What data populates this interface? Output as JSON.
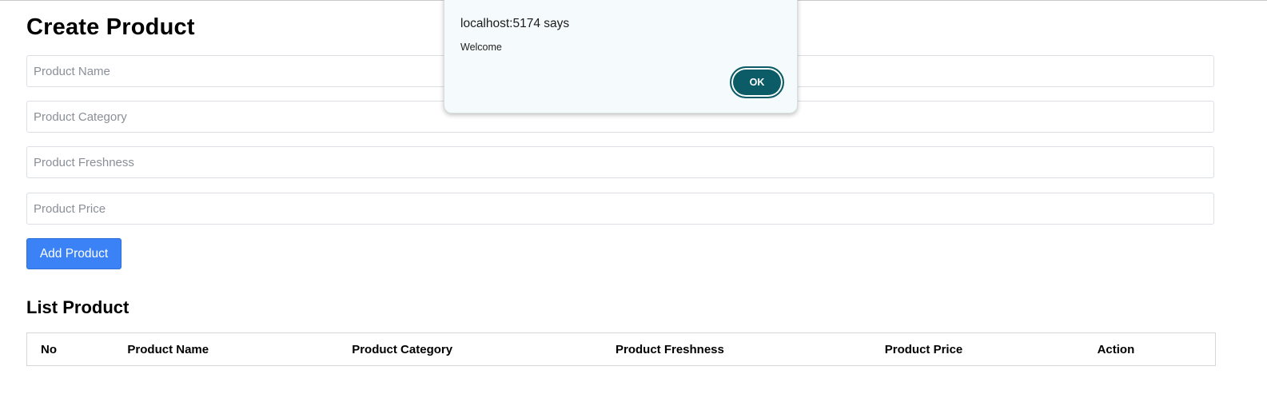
{
  "create": {
    "title": "Create Product",
    "fields": {
      "name_placeholder": "Product Name",
      "category_placeholder": "Product Category",
      "freshness_placeholder": "Product Freshness",
      "price_placeholder": "Product Price"
    },
    "add_button": "Add Product"
  },
  "list": {
    "title": "List Product",
    "columns": [
      "No",
      "Product Name",
      "Product Category",
      "Product Freshness",
      "Product Price",
      "Action"
    ]
  },
  "alert": {
    "title": "localhost:5174 says",
    "message": "Welcome",
    "ok_label": "OK"
  },
  "colors": {
    "primary_button": "#3b82f6",
    "dialog_button": "#0b5c66",
    "dialog_background": "#f5fafc"
  }
}
